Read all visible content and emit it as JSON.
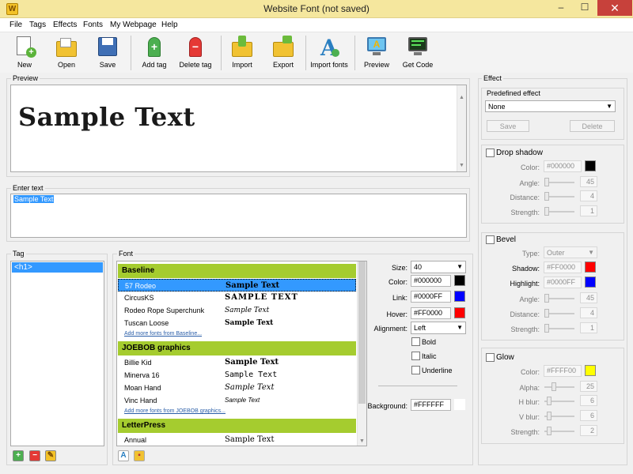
{
  "window": {
    "title": "Website Font  (not saved)",
    "minimize": "‒",
    "maximize": "☐",
    "close": "✕",
    "app_icon_letter": "W"
  },
  "menu": [
    "File",
    "Tags",
    "Effects",
    "Fonts",
    "My Webpage",
    "Help"
  ],
  "toolbar": {
    "new": "New",
    "open": "Open",
    "save": "Save",
    "add_tag": "Add tag",
    "delete_tag": "Delete tag",
    "import": "Import",
    "export": "Export",
    "import_fonts": "Import fonts",
    "preview": "Preview",
    "get_code": "Get Code"
  },
  "preview": {
    "label": "Preview",
    "sample_text": "Sample Text"
  },
  "enter_text": {
    "label": "Enter text",
    "value": "Sample Text"
  },
  "tag": {
    "label": "Tag",
    "items": [
      "<h1>"
    ]
  },
  "font": {
    "label": "Font",
    "categories": [
      {
        "name": "Baseline",
        "fonts": [
          {
            "name": "57 Rodeo",
            "sample": "Sample Text"
          },
          {
            "name": "CircusKS",
            "sample": "SAMPLE TEXT"
          },
          {
            "name": "Rodeo Rope Superchunk",
            "sample": "Sample Text"
          },
          {
            "name": "Tuscan Loose",
            "sample": "Sample Text"
          }
        ],
        "more": "Add more fonts from Baseline..."
      },
      {
        "name": "JOEBOB graphics",
        "fonts": [
          {
            "name": "Billie Kid",
            "sample": "Sample Text"
          },
          {
            "name": "Minerva 16",
            "sample": "Sample Text"
          },
          {
            "name": "Moan Hand",
            "sample": "Sample Text"
          },
          {
            "name": "Vinc Hand",
            "sample": "Sample Text"
          }
        ],
        "more": "Add more fonts from JOEBOB graphics..."
      },
      {
        "name": "LetterPress",
        "fonts": [
          {
            "name": "Annual",
            "sample": "Sample Text"
          }
        ]
      }
    ]
  },
  "props": {
    "size_label": "Size:",
    "size": "40",
    "color_label": "Color:",
    "color": "#000000",
    "link_label": "Link:",
    "link": "#0000FF",
    "hover_label": "Hover:",
    "hover": "#FF0000",
    "alignment_label": "Alignment:",
    "alignment": "Left",
    "bold": "Bold",
    "italic": "Italic",
    "underline": "Underline",
    "background_label": "Background:",
    "background": "#FFFFFF"
  },
  "effect": {
    "label": "Effect",
    "predefined_label": "Predefined effect",
    "predefined_value": "None",
    "save": "Save",
    "delete": "Delete",
    "drop_shadow": {
      "title": "Drop shadow",
      "color_label": "Color:",
      "color": "#000000",
      "angle_label": "Angle:",
      "angle": "45",
      "distance_label": "Distance:",
      "distance": "4",
      "strength_label": "Strength:",
      "strength": "1"
    },
    "bevel": {
      "title": "Bevel",
      "type_label": "Type:",
      "type": "Outer",
      "shadow_label": "Shadow:",
      "shadow": "#FF0000",
      "highlight_label": "Highlight:",
      "highlight": "#0000FF",
      "angle_label": "Angle:",
      "angle": "45",
      "distance_label": "Distance:",
      "distance": "4",
      "strength_label": "Strength:",
      "strength": "1"
    },
    "glow": {
      "title": "Glow",
      "color_label": "Color:",
      "color": "#FFFF00",
      "alpha_label": "Alpha:",
      "alpha": "25",
      "hblur_label": "H blur:",
      "hblur": "6",
      "vblur_label": "V blur:",
      "vblur": "6",
      "strength_label": "Strength:",
      "strength": "2"
    }
  },
  "colors": {
    "selection": "#3399ff",
    "category": "#a5cc2f",
    "black": "#000000",
    "blue": "#0000ff",
    "red": "#ff0000",
    "yellow": "#ffff00"
  },
  "icons": [
    "new-file-icon",
    "open-folder-icon",
    "save-disk-icon",
    "add-tag-icon",
    "delete-tag-icon",
    "import-icon",
    "export-icon",
    "import-fonts-icon",
    "preview-monitor-icon",
    "get-code-icon"
  ]
}
